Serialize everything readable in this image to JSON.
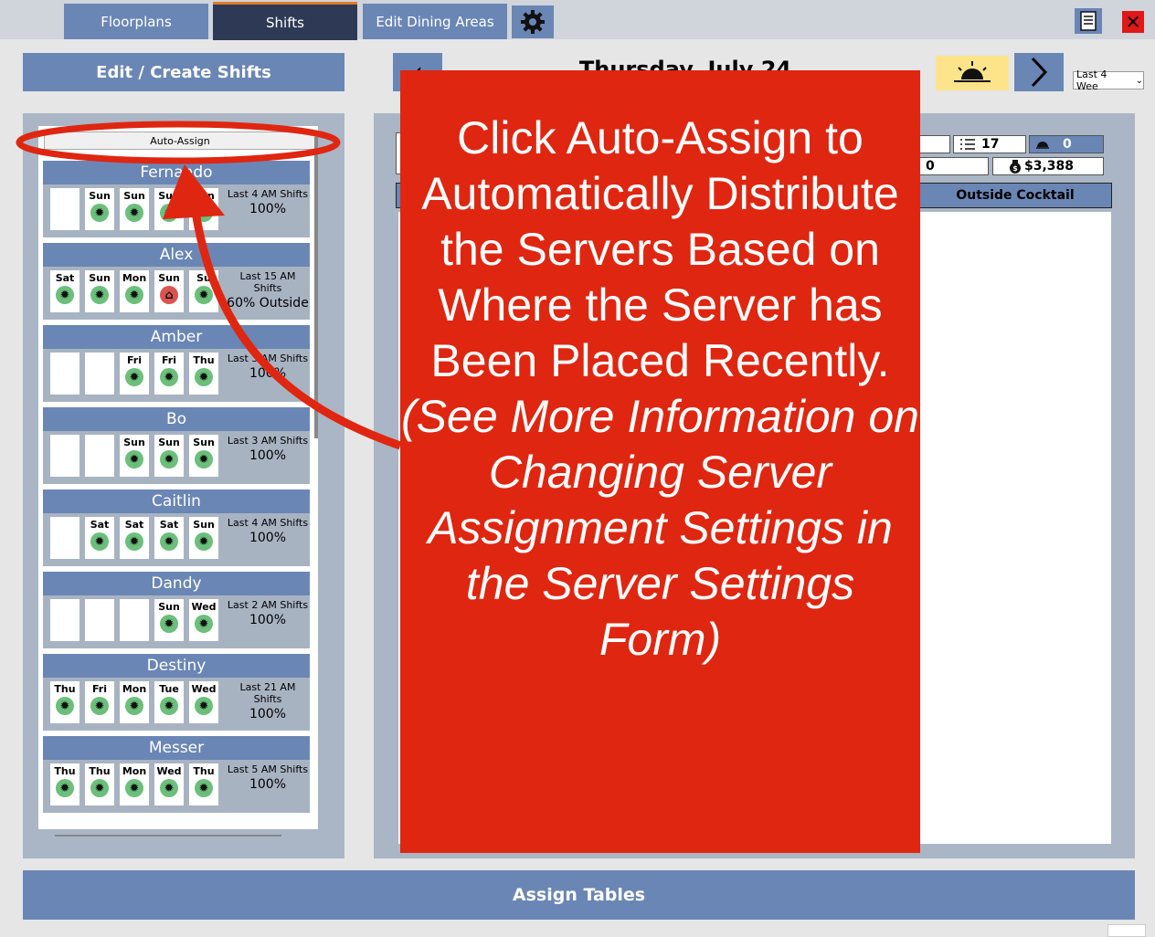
{
  "tabs": [
    {
      "label": "Floorplans"
    },
    {
      "label": "Shifts"
    },
    {
      "label": "Edit Dining Areas"
    }
  ],
  "toolbar": {
    "edit_label": "Edit / Create Shifts",
    "date": "Thursday, July 24",
    "period_select": "Last 4 Wee",
    "assign_label": "Assign Tables"
  },
  "list": {
    "auto_assign": "Auto-Assign"
  },
  "servers": [
    {
      "name": "Fernando",
      "days": [
        "",
        "Sun",
        "Sun",
        "Sun",
        "Sun"
      ],
      "shifts": "Last 4 AM Shifts",
      "pct": "100%"
    },
    {
      "name": "Alex",
      "days": [
        "Sat",
        "Sun",
        "Mon",
        "Sun",
        "Su"
      ],
      "shifts": "Last 15 AM Shifts",
      "pct": "60% Outside"
    },
    {
      "name": "Amber",
      "days": [
        "",
        "",
        "Fri",
        "Fri",
        "Thu"
      ],
      "shifts": "Last 3 AM Shifts",
      "pct": "100%"
    },
    {
      "name": "Bo",
      "days": [
        "",
        "",
        "Sun",
        "Sun",
        "Sun"
      ],
      "shifts": "Last 3 AM Shifts",
      "pct": "100%"
    },
    {
      "name": "Caitlin",
      "days": [
        "",
        "Sat",
        "Sat",
        "Sat",
        "Sun"
      ],
      "shifts": "Last 4 AM Shifts",
      "pct": "100%"
    },
    {
      "name": "Dandy",
      "days": [
        "",
        "",
        "",
        "Sun",
        "Wed"
      ],
      "shifts": "Last 2 AM Shifts",
      "pct": "100%"
    },
    {
      "name": "Destiny",
      "days": [
        "Thu",
        "Fri",
        "Mon",
        "Tue",
        "Wed"
      ],
      "shifts": "Last 21 AM Shifts",
      "pct": "100%"
    },
    {
      "name": "Messer",
      "days": [
        "Thu",
        "Thu",
        "Mon",
        "Wed",
        "Thu"
      ],
      "shifts": "Last 5 AM Shifts",
      "pct": "100%"
    }
  ],
  "stats": {
    "covers": "17",
    "reservations": "0",
    "cocktail_count": "0",
    "sales": "$3,388",
    "area": "Outside Cocktail"
  },
  "callout": {
    "main": "Click Auto-Assign to Automatically Distribute the Servers Based on Where the Server has Been Placed Recently.",
    "italic": "(See More Information on Changing Server Assignment Settings in the Server Settings Form)"
  },
  "colors": {
    "primary": "#6a86b5",
    "callout": "#df2611",
    "active_tab": "#2e3a55"
  }
}
